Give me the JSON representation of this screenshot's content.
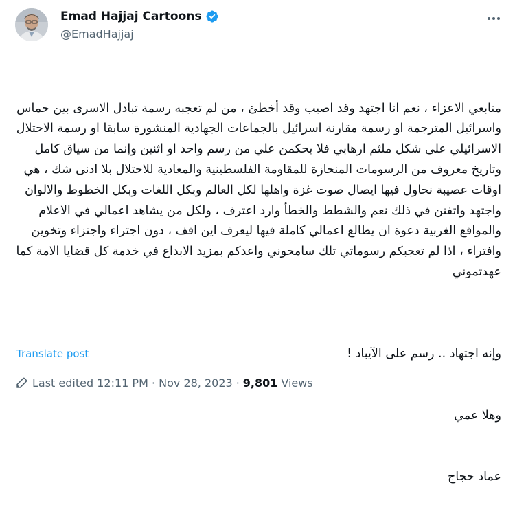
{
  "user": {
    "display_name": "Emad Hajjaj Cartoons",
    "handle": "@EmadHajjaj",
    "verified_color": "#1d9bf0"
  },
  "icons": {
    "verified": "verified-badge-icon",
    "more": "more-options-icon",
    "edit": "pencil-icon"
  },
  "post": {
    "paragraph": "متابعي الاعزاء ، نعم انا اجتهد وقد اصيب وقد أخطئ ، من لم تعجبه رسمة تبادل الاسرى بين حماس واسرائيل المترجمة او رسمة مقارنة اسرائيل بالجماعات الجهادية المنشورة سابقا او رسمة الاحتلال الاسرائيلي على شكل ملثم ارهابي فلا يحكمن علي من رسم واحد او اثنين وإنما من سياق كامل وتاريخ معروف من الرسومات المنحازة للمقاومة الفلسطينية والمعادية للاحتلال بلا ادنى شك ، هي اوقات عصيبة نحاول فيها ايصال صوت غزة واهلها لكل العالم وبكل اللغات وبكل الخطوط والالوان واجتهد واتفنن في ذلك نعم والشطط والخطأ وارد اعترف ، ولكل من يشاهد اعمالي في الاعلام والمواقع الغربية دعوة ان يطالع اعمالي كاملة فيها ليعرف اين اقف ، دون اجتراء واجتزاء وتخوين وافتراء ، اذا لم تعجبكم رسوماتي تلك سامحوني واعدكم بمزيد الابداع في خدمة كل قضايا الامة كما عهدتموني",
    "sign_line1": "وإنه اجتهاد .. رسم على الآيباد !",
    "sign_line2": "وهلا عمي",
    "sign_line3": "عماد حجاج"
  },
  "translate_label": "Translate post",
  "meta": {
    "edited_label": "Last edited 12:11 PM · Nov 28, 2023",
    "separator": "·",
    "views_count": "9,801",
    "views_label": "Views"
  }
}
